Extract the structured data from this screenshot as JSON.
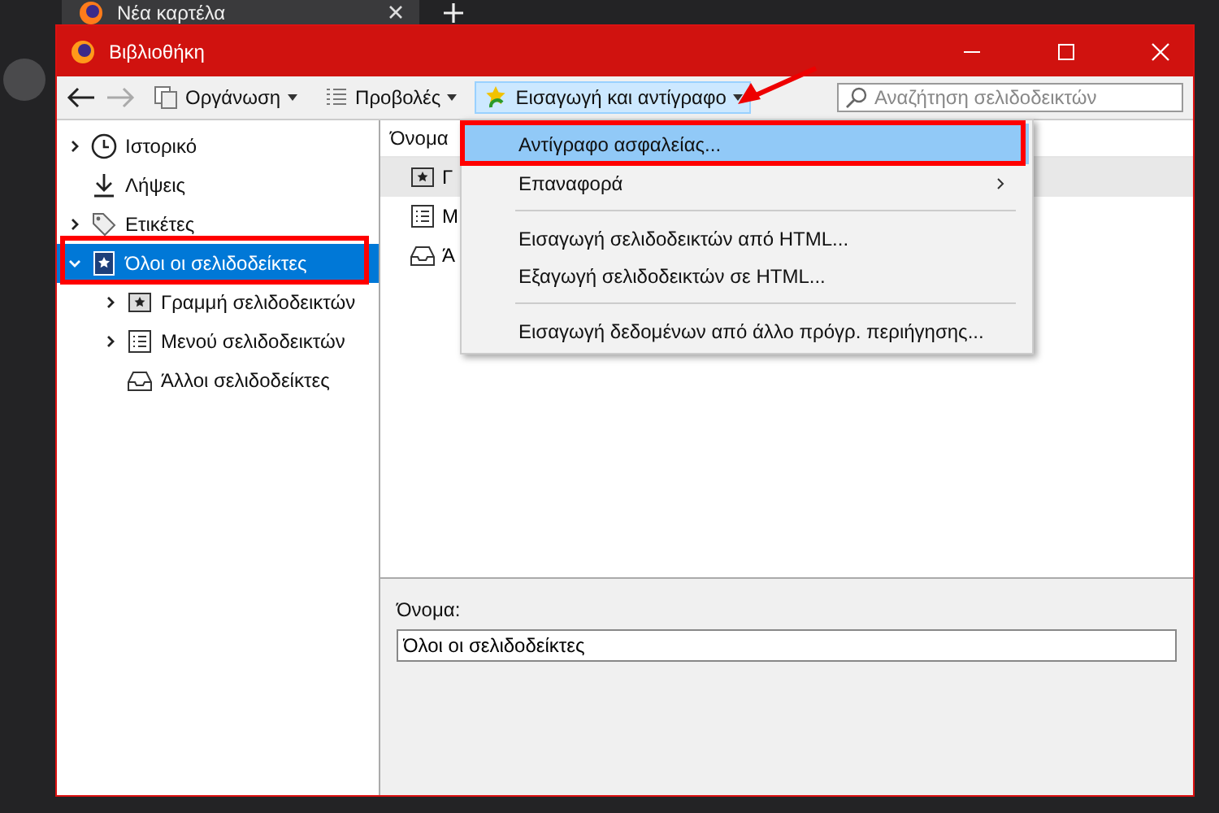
{
  "browser": {
    "tab_title": "Νέα καρτέλα"
  },
  "window": {
    "title": "Βιβλιοθήκη"
  },
  "toolbar": {
    "organize": "Οργάνωση",
    "views": "Προβολές",
    "import_export": "Εισαγωγή και αντίγραφο",
    "search": {
      "placeholder": "Αναζήτηση σελιδοδεικτών"
    }
  },
  "sidebar": {
    "items": [
      {
        "kind": "history",
        "label": "Ιστορικό",
        "expanded": false,
        "selected": false
      },
      {
        "kind": "downloads",
        "label": "Λήψεις",
        "selected": false
      },
      {
        "kind": "tags",
        "label": "Ετικέτες",
        "expanded": false,
        "selected": false
      },
      {
        "kind": "bookmarks",
        "label": "Όλοι οι σελιδοδείκτες",
        "expanded": true,
        "selected": true,
        "children": [
          {
            "kind": "toolbar",
            "label": "Γραμμή σελιδοδεικτών",
            "expanded": false,
            "selected": false
          },
          {
            "kind": "menu",
            "label": "Μενού σελιδοδεικτών",
            "expanded": false,
            "selected": false
          },
          {
            "kind": "unsorted",
            "label": "Άλλοι σελιδοδείκτες",
            "selected": false
          }
        ]
      }
    ]
  },
  "list": {
    "column": "Όνομα",
    "rows": [
      {
        "kind": "toolbar",
        "label": "Γ",
        "selected": true
      },
      {
        "kind": "menu",
        "label": "Μ",
        "selected": false
      },
      {
        "kind": "unsorted",
        "label": "Ά",
        "selected": false
      }
    ]
  },
  "menu": {
    "items": [
      {
        "kind": "item",
        "label": "Αντίγραφο ασφαλείας...",
        "selected": true
      },
      {
        "kind": "submenu",
        "label": "Επαναφορά",
        "selected": false
      },
      {
        "kind": "separator"
      },
      {
        "kind": "item",
        "label": "Εισαγωγή σελιδοδεικτών από HTML...",
        "selected": false
      },
      {
        "kind": "item",
        "label": "Εξαγωγή σελιδοδεικτών σε HTML...",
        "selected": false
      },
      {
        "kind": "separator"
      },
      {
        "kind": "item",
        "label": "Εισαγωγή δεδομένων από άλλο πρόγρ. περιήγησης...",
        "selected": false
      }
    ]
  },
  "details": {
    "label": "Όνομα:",
    "value": "Όλοι οι σελιδοδείκτες"
  }
}
